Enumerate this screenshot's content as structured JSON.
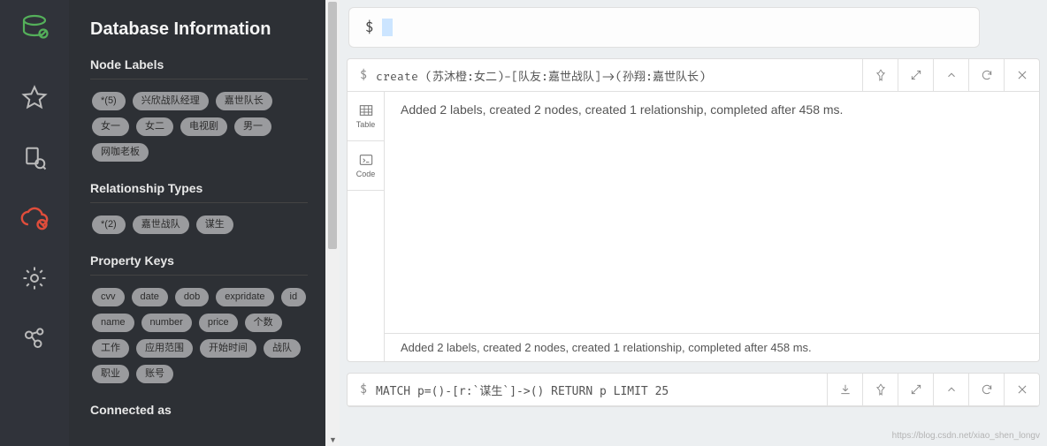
{
  "sidebar": {
    "title": "Database Information",
    "node_labels": {
      "heading": "Node Labels",
      "chips": [
        "*(5)",
        "兴欣战队经理",
        "嘉世队长",
        "女一",
        "女二",
        "电视剧",
        "男一",
        "网咖老板"
      ]
    },
    "relationship_types": {
      "heading": "Relationship Types",
      "chips": [
        "*(2)",
        "嘉世战队",
        "谋生"
      ]
    },
    "property_keys": {
      "heading": "Property Keys",
      "chips": [
        "cvv",
        "date",
        "dob",
        "expridate",
        "id",
        "name",
        "number",
        "price",
        "个数",
        "工作",
        "应用范围",
        "开始时间",
        "战队",
        "职业",
        "账号"
      ]
    },
    "connected": {
      "heading": "Connected as"
    }
  },
  "query_bar": {
    "prompt": "$"
  },
  "frame1": {
    "prompt": "$",
    "command": "create (苏沐橙:女二)-[队友:嘉世战队]->(孙翔:嘉世队长)",
    "result_main": "Added 2 labels, created 2 nodes, created 1 relationship, completed after 458 ms.",
    "result_footer": "Added 2 labels, created 2 nodes, created 1 relationship, completed after 458 ms.",
    "tabs": {
      "table": "Table",
      "code": "Code"
    }
  },
  "frame2": {
    "prompt": "$",
    "command": "MATCH p=()-[r:`谋生`]->() RETURN p LIMIT 25"
  },
  "watermark": "https://blog.csdn.net/xiao_shen_longv"
}
